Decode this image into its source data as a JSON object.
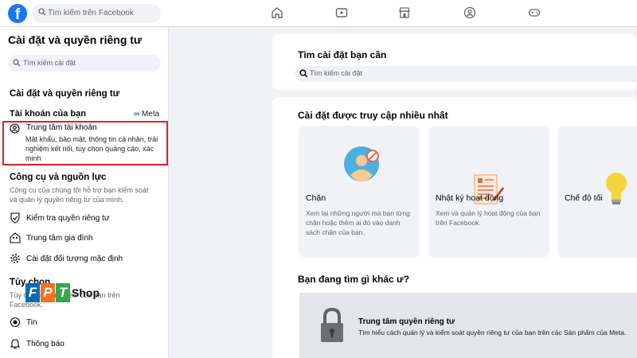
{
  "topbar": {
    "search_placeholder": "Tìm kiếm trên Facebook",
    "nav": [
      "home-icon",
      "watch-icon",
      "marketplace-icon",
      "groups-icon",
      "gaming-icon"
    ]
  },
  "sidebar": {
    "title": "Cài đặt và quyền riêng tư",
    "search_placeholder": "Tìm kiếm cài đặt",
    "section_heading": "Cài đặt và quyền riêng tư",
    "accounts": {
      "heading": "Tài khoản của bạn",
      "meta_label": "Meta",
      "center_label": "Trung tâm tài khoản",
      "center_desc": "Mật khẩu, bảo mật, thông tin cá nhân, trải nghiệm kết nối, tùy chọn quảng cáo, xác minh"
    },
    "tools": {
      "heading": "Công cụ và nguồn lực",
      "desc": "Công cụ của chúng tôi hỗ trợ bạn kiểm soát và quản lý quyền riêng tư của mình.",
      "items": [
        {
          "label": "Kiểm tra quyền riêng tư",
          "icon": "privacy-check-icon"
        },
        {
          "label": "Trung tâm gia đình",
          "icon": "family-center-icon"
        },
        {
          "label": "Cài đặt đối tượng mặc định",
          "icon": "gear-icon"
        }
      ]
    },
    "options": {
      "heading": "Tùy chọn",
      "desc": "Tùy chỉnh trải nghiệm của bạn trên Facebook.",
      "items": [
        {
          "label": "Tin",
          "icon": "stories-icon"
        },
        {
          "label": "Thông báo",
          "icon": "bell-icon"
        }
      ]
    }
  },
  "watermark": {
    "letters": [
      "F",
      "P",
      "T"
    ],
    "shop": "Shop"
  },
  "main": {
    "search_card": {
      "title": "Tìm cài đặt bạn cần",
      "placeholder": "Tìm kiếm cài đặt"
    },
    "frequent": {
      "title": "Cài đặt được truy cập nhiều nhất",
      "tiles": [
        {
          "name": "Chặn",
          "desc": "Xem lại những người mà bạn từng chặn hoặc thêm ai đó vào danh sách chặn của bạn.",
          "icon": "block-user-icon"
        },
        {
          "name": "Nhật ký hoạt động",
          "desc": "Xem và quản lý hoạt động của bạn trên Facebook.",
          "icon": "activity-log-icon"
        },
        {
          "name": "Chế độ tối",
          "desc": "",
          "icon": "lightbulb-icon"
        }
      ]
    },
    "other": {
      "title": "Bạn đang tìm gì khác ư?",
      "banner_title": "Trung tâm quyền riêng tư",
      "banner_desc": "Tìm hiểu cách quản lý và kiểm soát quyền riêng tư của bạn trên các Sản phẩm của Meta."
    }
  },
  "colors": {
    "brand": "#1877f2",
    "highlight": "#e41e26",
    "bg": "#f0f2f5"
  }
}
